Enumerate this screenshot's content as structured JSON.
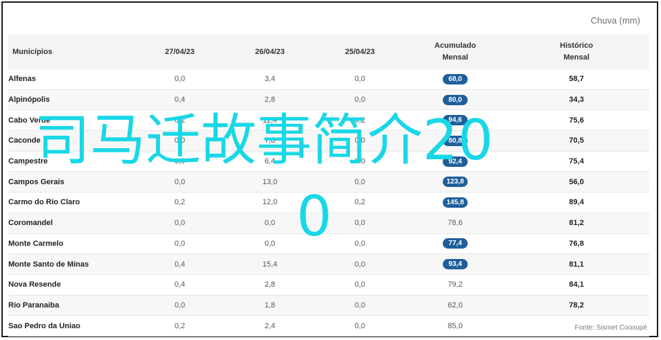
{
  "header": {
    "group_label": "Chuva (mm)",
    "columns": [
      "Municípios",
      "27/04/23",
      "26/04/23",
      "25/04/23",
      "Acumulado\nMensal",
      "Histórico\nMensal"
    ]
  },
  "rows": [
    {
      "mun": "Alfenas",
      "d27": "0,0",
      "d26": "3,4",
      "d25": "0,0",
      "acum": "68,0",
      "acum_badge": true,
      "hist": "58,7"
    },
    {
      "mun": "Alpinópolis",
      "d27": "0,4",
      "d26": "2,8",
      "d25": "0,0",
      "acum": "80,0",
      "acum_badge": true,
      "hist": "34,3"
    },
    {
      "mun": "Cabo Verde",
      "d27": "0,2",
      "d26": "11,4",
      "d25": "0,2",
      "acum": "94,6",
      "acum_badge": true,
      "hist": "75,6"
    },
    {
      "mun": "Caconde",
      "d27": "0,0",
      "d26": "7,8",
      "d25": "0,0",
      "acum": "80,8",
      "acum_badge": true,
      "hist": "70,5"
    },
    {
      "mun": "Campestre",
      "d27": "0,0",
      "d26": "6,4",
      "d25": "0,0",
      "acum": "92,4",
      "acum_badge": true,
      "hist": "75,4"
    },
    {
      "mun": "Campos Gerais",
      "d27": "0,0",
      "d26": "13,0",
      "d25": "0,0",
      "acum": "123,8",
      "acum_badge": true,
      "hist": "56,0"
    },
    {
      "mun": "Carmo do Rio Claro",
      "d27": "0,2",
      "d26": "12,0",
      "d25": "0,2",
      "acum": "145,8",
      "acum_badge": true,
      "hist": "89,4"
    },
    {
      "mun": "Coromandel",
      "d27": "0,0",
      "d26": "0,0",
      "d25": "0,0",
      "acum": "78,6",
      "acum_badge": false,
      "hist": "81,2"
    },
    {
      "mun": "Monte Carmelo",
      "d27": "0,0",
      "d26": "0,0",
      "d25": "0,0",
      "acum": "77,4",
      "acum_badge": true,
      "hist": "76,8"
    },
    {
      "mun": "Monte Santo de Minas",
      "d27": "0,4",
      "d26": "15,4",
      "d25": "0,0",
      "acum": "93,4",
      "acum_badge": true,
      "hist": "81,1"
    },
    {
      "mun": "Nova Resende",
      "d27": "0,4",
      "d26": "2,8",
      "d25": "0,0",
      "acum": "79,2",
      "acum_badge": false,
      "hist": "84,1"
    },
    {
      "mun": "Rio Paranaiba",
      "d27": "0,0",
      "d26": "1,8",
      "d25": "0,0",
      "acum": "62,0",
      "acum_badge": false,
      "hist": "78,2"
    },
    {
      "mun": "Sao Pedro da Uniao",
      "d27": "0,2",
      "d26": "2,4",
      "d25": "0,0",
      "acum": "85,0",
      "acum_badge": false,
      "hist": ""
    }
  ],
  "footer": {
    "source": "Fonte: Sismet Cooxupé"
  },
  "overlay": {
    "line1": "司马迁故事简介20",
    "line2": "0"
  },
  "colors": {
    "badge": "#1f5f9a",
    "overlay": "#19d7e6",
    "header_bg": "#f4f4f4"
  }
}
